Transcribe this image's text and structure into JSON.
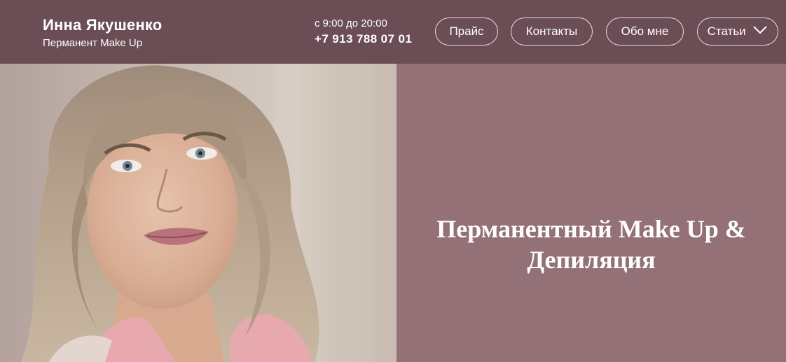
{
  "header": {
    "brand_name": "Инна Якушенко",
    "brand_subtitle": "Перманент Make Up",
    "hours": "с 9:00 до 20:00",
    "phone": "+7 913 788 07 01"
  },
  "nav": {
    "price": "Прайс",
    "contacts": "Контакты",
    "about": "Обо мне",
    "articles": "Статьи"
  },
  "hero": {
    "title_line1": "Перманентный Make Up &",
    "title_line2": "Депиляция"
  },
  "colors": {
    "header_bg": "#6b4d55",
    "panel_bg": "#937177",
    "text": "#ffffff"
  },
  "icons": {
    "articles_dropdown": "chevron-down-icon"
  }
}
